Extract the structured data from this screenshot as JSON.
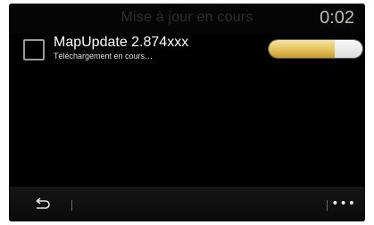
{
  "header": {
    "title": "Mise à jour en cours",
    "clock": "0:02"
  },
  "update_item": {
    "name": "MapUpdate 2.874xxx",
    "status": "Téléchargement en cours…",
    "progress_fraction": 0.7
  },
  "bottom_bar": {
    "back_icon": "back-arrow-icon",
    "more_icon": "more-options-icon",
    "more_label": "•••"
  },
  "colors": {
    "background": "#000000",
    "progress_fill": "#e7c867",
    "progress_track": "#e6e6e6"
  }
}
